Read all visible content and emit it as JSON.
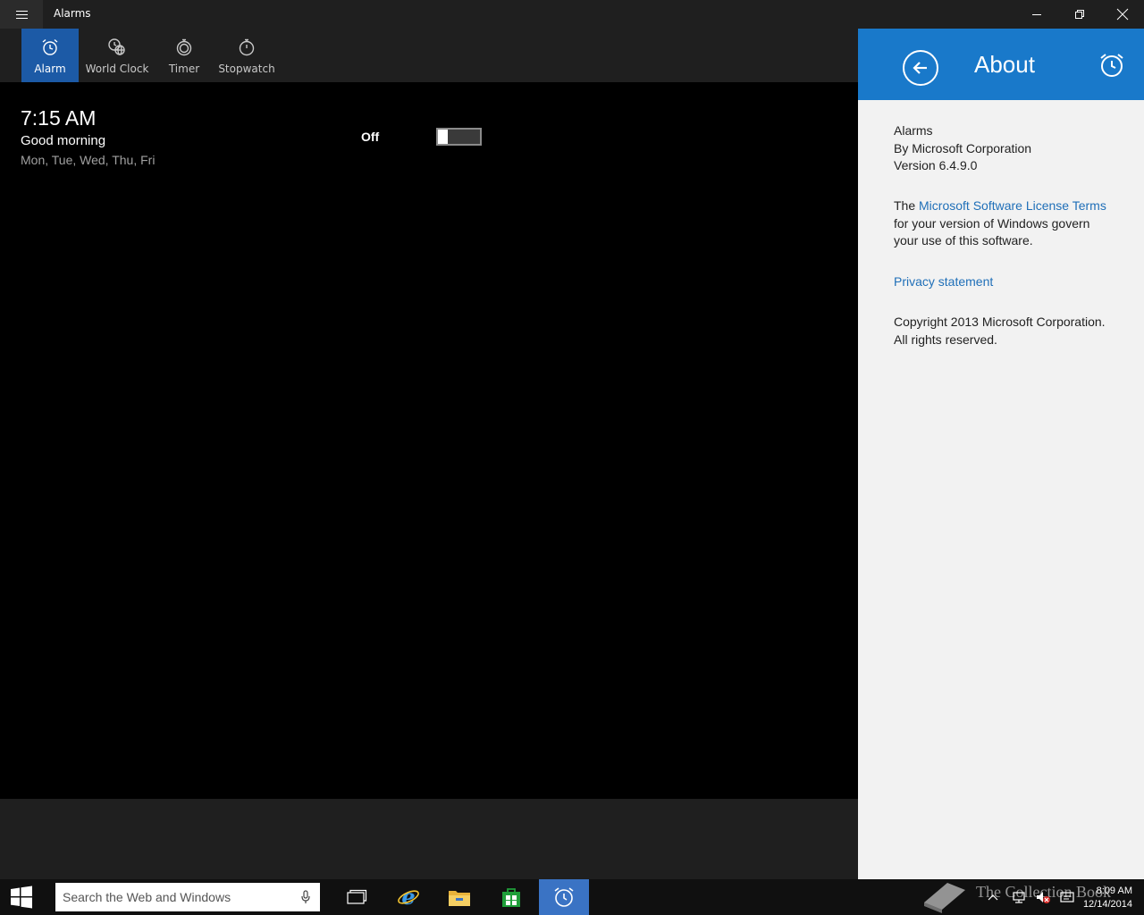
{
  "window": {
    "title": "Alarms"
  },
  "tabs": [
    {
      "label": "Alarm",
      "icon": "alarm-clock-icon",
      "active": true
    },
    {
      "label": "World Clock",
      "icon": "world-clock-icon",
      "active": false
    },
    {
      "label": "Timer",
      "icon": "timer-icon",
      "active": false
    },
    {
      "label": "Stopwatch",
      "icon": "stopwatch-icon",
      "active": false
    }
  ],
  "alarm": {
    "time": "7:15 AM",
    "name": "Good morning",
    "days": "Mon, Tue, Wed, Thu, Fri",
    "state_label": "Off"
  },
  "about": {
    "title": "About",
    "app_name": "Alarms",
    "publisher": "By Microsoft Corporation",
    "version": "Version 6.4.9.0",
    "license_pre": "The ",
    "license_link": "Microsoft Software License Terms",
    "license_post": " for your version of Windows govern your use of this software.",
    "privacy_link": "Privacy statement",
    "copyright": "Copyright 2013 Microsoft Corporation. All rights reserved."
  },
  "taskbar": {
    "search_placeholder": "Search the Web and Windows",
    "time": "8:09 AM",
    "date": "12/14/2014",
    "watermark": "The Collection Book"
  },
  "colors": {
    "accent": "#1979ca",
    "active_tab": "#1c5aa6",
    "link": "#1f6fb8"
  }
}
